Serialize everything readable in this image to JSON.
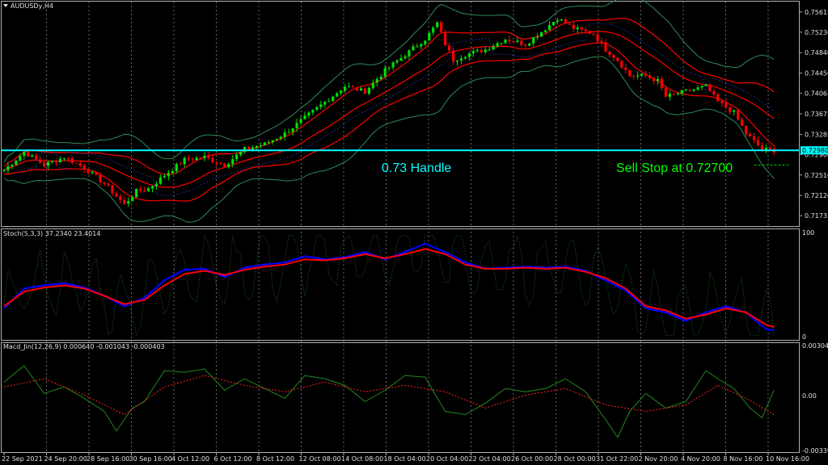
{
  "window": {
    "symbol_label": "AUDUSDy,H4"
  },
  "annotations": {
    "handle_label": "0.73 Handle",
    "sell_stop_label": "Sell Stop at 0.72700",
    "price_badge": "0.72980"
  },
  "panels": {
    "stoch_header": "Stoch(5,3,3) 37.2340 23.4014",
    "stoch_top": "100",
    "stoch_bottom": "0",
    "macd_header": "Macd_Jin(12,26,9) 0.000640 -0.001043 -0.000403",
    "macd_top": "0.003041",
    "macd_mid": "0.00",
    "macd_bottom": "-0.003399"
  },
  "colors": {
    "background": "#000000",
    "bull_candle": "#00e000",
    "bear_candle": "#ff0000",
    "bands_red": "#ff0000",
    "bands_outer": "#2e8b57",
    "support_line": "#00ffff",
    "stoch_main": "#0000ff",
    "stoch_signal": "#ff0000",
    "macd_line": "#1f7a1f",
    "macd_signal": "#ff2020",
    "handle_text": "#00ffff",
    "sell_stop_text": "#00ff00"
  },
  "chart_data": [
    {
      "type": "candlestick",
      "title": "AUDUSDy,H4",
      "ylim": [
        0.716,
        0.7575
      ],
      "y_ticks": [
        "0.75615",
        "0.75230",
        "0.74840",
        "0.74450",
        "0.74065",
        "0.73675",
        "0.73285",
        "0.72900",
        "0.72510",
        "0.72120",
        "0.71735"
      ],
      "x_tick_labels": [
        "22 Sep 2021",
        "24 Sep 20:00",
        "28 Sep 16:00",
        "30 Sep 16:00",
        "4 Oct 12:00",
        "6 Oct 12:00",
        "8 Oct 12:00",
        "12 Oct 08:00",
        "14 Oct 08:00",
        "18 Oct 04:00",
        "20 Oct 04:00",
        "22 Oct 04:00",
        "26 Oct 00:00",
        "28 Oct 00:00",
        "31 Oct 22:00",
        "2 Nov 20:00",
        "4 Nov 20:00",
        "8 Nov 16:00",
        "10 Nov 16:00"
      ],
      "close_anchors": [
        [
          0,
          0.726
        ],
        [
          5,
          0.7295
        ],
        [
          10,
          0.727
        ],
        [
          15,
          0.7285
        ],
        [
          20,
          0.7265
        ],
        [
          25,
          0.7235
        ],
        [
          30,
          0.7195
        ],
        [
          33,
          0.722
        ],
        [
          36,
          0.7225
        ],
        [
          40,
          0.725
        ],
        [
          45,
          0.728
        ],
        [
          50,
          0.7285
        ],
        [
          55,
          0.727
        ],
        [
          60,
          0.73
        ],
        [
          65,
          0.731
        ],
        [
          70,
          0.733
        ],
        [
          75,
          0.736
        ],
        [
          80,
          0.739
        ],
        [
          85,
          0.742
        ],
        [
          90,
          0.741
        ],
        [
          95,
          0.745
        ],
        [
          100,
          0.748
        ],
        [
          105,
          0.751
        ],
        [
          108,
          0.754
        ],
        [
          110,
          0.75
        ],
        [
          112,
          0.747
        ],
        [
          115,
          0.748
        ],
        [
          120,
          0.749
        ],
        [
          125,
          0.751
        ],
        [
          130,
          0.75
        ],
        [
          135,
          0.753
        ],
        [
          138,
          0.755
        ],
        [
          142,
          0.753
        ],
        [
          147,
          0.752
        ],
        [
          150,
          0.749
        ],
        [
          153,
          0.747
        ],
        [
          156,
          0.744
        ],
        [
          160,
          0.744
        ],
        [
          163,
          0.743
        ],
        [
          165,
          0.74
        ],
        [
          170,
          0.741
        ],
        [
          175,
          0.742
        ],
        [
          178,
          0.739
        ],
        [
          182,
          0.737
        ],
        [
          185,
          0.733
        ],
        [
          189,
          0.73
        ],
        [
          192,
          0.7298
        ]
      ],
      "support_level": 0.7298,
      "sell_stop_level": 0.727,
      "band_lookback": 20
    },
    {
      "type": "line",
      "title": "Stoch(5,3,3) 37.2340 23.4014",
      "ylim": [
        0,
        100
      ],
      "series": [
        {
          "name": "Stoch(5,3,3)",
          "points": [
            [
              0,
              28
            ],
            [
              5,
              47
            ],
            [
              10,
              50
            ],
            [
              15,
              52
            ],
            [
              20,
              48
            ],
            [
              25,
              40
            ],
            [
              30,
              30
            ],
            [
              35,
              38
            ],
            [
              40,
              55
            ],
            [
              45,
              65
            ],
            [
              50,
              66
            ],
            [
              55,
              58
            ],
            [
              60,
              67
            ],
            [
              65,
              70
            ],
            [
              70,
              72
            ],
            [
              75,
              78
            ],
            [
              80,
              75
            ],
            [
              85,
              77
            ],
            [
              90,
              82
            ],
            [
              95,
              75
            ],
            [
              100,
              82
            ],
            [
              105,
              90
            ],
            [
              110,
              82
            ],
            [
              115,
              72
            ],
            [
              120,
              66
            ],
            [
              125,
              67
            ],
            [
              130,
              68
            ],
            [
              135,
              67
            ],
            [
              140,
              68
            ],
            [
              145,
              64
            ],
            [
              150,
              55
            ],
            [
              155,
              45
            ],
            [
              160,
              28
            ],
            [
              165,
              24
            ],
            [
              170,
              16
            ],
            [
              175,
              24
            ],
            [
              180,
              30
            ],
            [
              185,
              24
            ],
            [
              190,
              8
            ],
            [
              192,
              7
            ]
          ]
        },
        {
          "points": [
            [
              0,
              30
            ],
            [
              5,
              44
            ],
            [
              10,
              48
            ],
            [
              15,
              50
            ],
            [
              20,
              47
            ],
            [
              25,
              40
            ],
            [
              30,
              32
            ],
            [
              35,
              36
            ],
            [
              40,
              50
            ],
            [
              45,
              61
            ],
            [
              50,
              64
            ],
            [
              55,
              60
            ],
            [
              60,
              65
            ],
            [
              65,
              68
            ],
            [
              70,
              70
            ],
            [
              75,
              75
            ],
            [
              80,
              74
            ],
            [
              85,
              76
            ],
            [
              90,
              80
            ],
            [
              95,
              76
            ],
            [
              100,
              80
            ],
            [
              105,
              85
            ],
            [
              110,
              80
            ],
            [
              115,
              70
            ],
            [
              120,
              66
            ],
            [
              125,
              66
            ],
            [
              130,
              67
            ],
            [
              135,
              66
            ],
            [
              140,
              67
            ],
            [
              145,
              63
            ],
            [
              150,
              57
            ],
            [
              155,
              47
            ],
            [
              160,
              30
            ],
            [
              165,
              26
            ],
            [
              170,
              18
            ],
            [
              175,
              22
            ],
            [
              180,
              28
            ],
            [
              185,
              24
            ],
            [
              190,
              12
            ],
            [
              192,
              10
            ]
          ]
        }
      ]
    },
    {
      "type": "line",
      "title": "Macd_Jin(12,26,9) 0.000640 -0.001043 -0.000403",
      "ylim": [
        -0.003399,
        0.003041
      ],
      "series": [
        {
          "name": "Macd_Jin(12,26,9)",
          "points": [
            [
              0,
              0.0008
            ],
            [
              5,
              0.0018
            ],
            [
              10,
              0.0001
            ],
            [
              15,
              0.0005
            ],
            [
              20,
              -0.0002
            ],
            [
              25,
              -0.001
            ],
            [
              28,
              -0.0022
            ],
            [
              32,
              -0.0008
            ],
            [
              35,
              -0.0004
            ],
            [
              40,
              0.0015
            ],
            [
              45,
              0.0014
            ],
            [
              50,
              0.0016
            ],
            [
              55,
              0.0003
            ],
            [
              60,
              0.001
            ],
            [
              65,
              0.0004
            ],
            [
              70,
              -0.0002
            ],
            [
              75,
              0.0012
            ],
            [
              80,
              0.001
            ],
            [
              85,
              0.0006
            ],
            [
              90,
              -0.0004
            ],
            [
              95,
              0.0003
            ],
            [
              100,
              0.0012
            ],
            [
              105,
              0.0011
            ],
            [
              110,
              -0.001
            ],
            [
              115,
              -0.0012
            ],
            [
              120,
              -0.0005
            ],
            [
              125,
              0.0004
            ],
            [
              130,
              0.0002
            ],
            [
              135,
              0.0004
            ],
            [
              140,
              0.001
            ],
            [
              145,
              0.0002
            ],
            [
              150,
              -0.0015
            ],
            [
              153,
              -0.0026
            ],
            [
              156,
              -0.001
            ],
            [
              160,
              0.0001
            ],
            [
              165,
              -0.0008
            ],
            [
              170,
              -0.0004
            ],
            [
              175,
              0.0015
            ],
            [
              178,
              0.001
            ],
            [
              182,
              0.0004
            ],
            [
              186,
              -0.0008
            ],
            [
              189,
              -0.0014
            ],
            [
              192,
              0.0003
            ]
          ]
        },
        {
          "points": [
            [
              0,
              0.0005
            ],
            [
              10,
              0.001
            ],
            [
              20,
              0.0
            ],
            [
              30,
              -0.0012
            ],
            [
              40,
              0.0005
            ],
            [
              50,
              0.0012
            ],
            [
              60,
              0.0006
            ],
            [
              70,
              0.0002
            ],
            [
              80,
              0.0008
            ],
            [
              90,
              0.0002
            ],
            [
              100,
              0.0006
            ],
            [
              110,
              0.0002
            ],
            [
              120,
              -0.0008
            ],
            [
              130,
              0.0
            ],
            [
              140,
              0.0004
            ],
            [
              150,
              -0.0006
            ],
            [
              160,
              -0.001
            ],
            [
              170,
              -0.0006
            ],
            [
              178,
              0.0006
            ],
            [
              185,
              -0.0002
            ],
            [
              192,
              -0.0012
            ]
          ]
        }
      ]
    }
  ]
}
